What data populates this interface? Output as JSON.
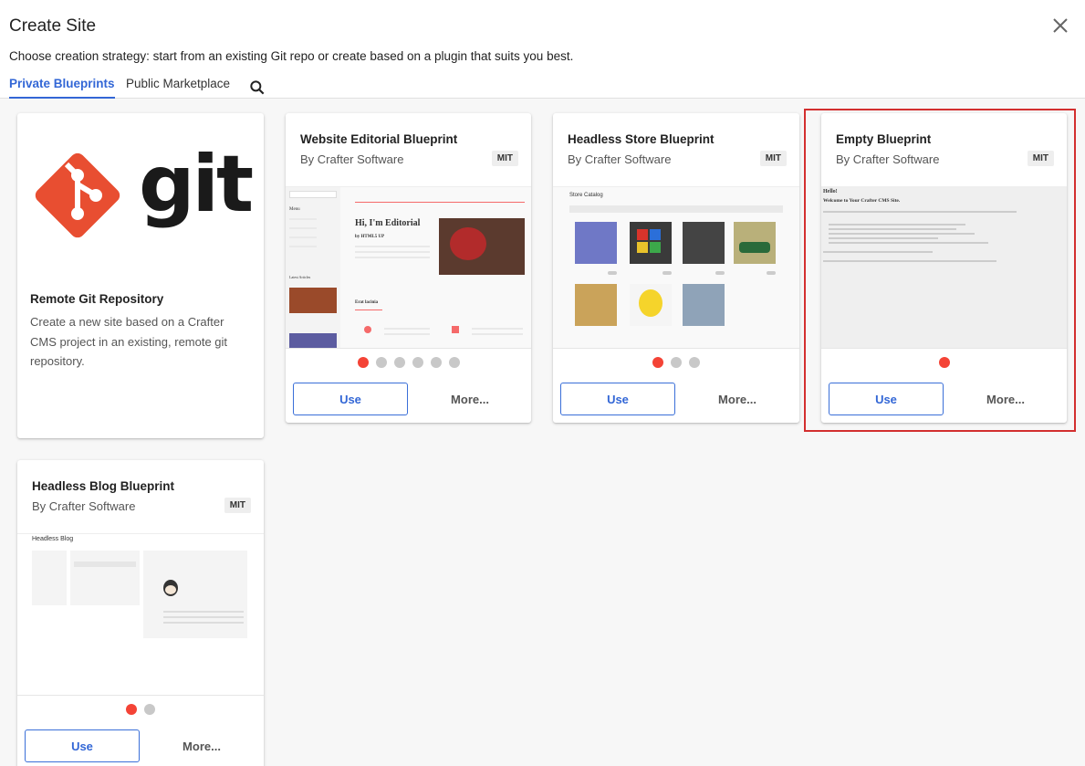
{
  "dialog": {
    "title": "Create Site",
    "subtitle": "Choose creation strategy: start from an existing Git repo or create based on a plugin that suits you best."
  },
  "tabs": [
    {
      "label": "Private Blueprints",
      "active": true
    },
    {
      "label": "Public Marketplace",
      "active": false
    }
  ],
  "icons": {
    "close": "close-icon",
    "search": "search-icon"
  },
  "colors": {
    "accent": "#3367d6",
    "dot_active": "#f44336",
    "highlight": "#d32f2f",
    "git_logo": "#e84e31"
  },
  "git_card": {
    "logo_text": "git",
    "title": "Remote Git Repository",
    "description": "Create a new site based on a Crafter CMS project in an existing, remote git repository."
  },
  "blueprints": [
    {
      "title": "Website Editorial Blueprint",
      "author": "By Crafter Software",
      "license": "MIT",
      "slides": 6,
      "active_slide": 0,
      "use_label": "Use",
      "more_label": "More...",
      "preview": {
        "heading": "Hi, I'm Editorial",
        "sub": "by HTML5 UP",
        "section": "Erat lacinia",
        "menu": "Menu",
        "latest": "Latest Articles"
      }
    },
    {
      "title": "Headless Store Blueprint",
      "author": "By Crafter Software",
      "license": "MIT",
      "slides": 3,
      "active_slide": 0,
      "use_label": "Use",
      "more_label": "More...",
      "preview": {
        "heading": "Store Catalog"
      }
    },
    {
      "title": "Empty Blueprint",
      "author": "By Crafter Software",
      "license": "MIT",
      "slides": 1,
      "active_slide": 0,
      "use_label": "Use",
      "more_label": "More...",
      "preview": {
        "hello": "Hello!",
        "welcome": "Welcome to Your Crafter CMS Site."
      }
    },
    {
      "title": "Headless Blog Blueprint",
      "author": "By Crafter Software",
      "license": "MIT",
      "slides": 2,
      "active_slide": 0,
      "use_label": "Use",
      "more_label": "More...",
      "preview": {
        "heading": "Headless Blog"
      }
    }
  ]
}
